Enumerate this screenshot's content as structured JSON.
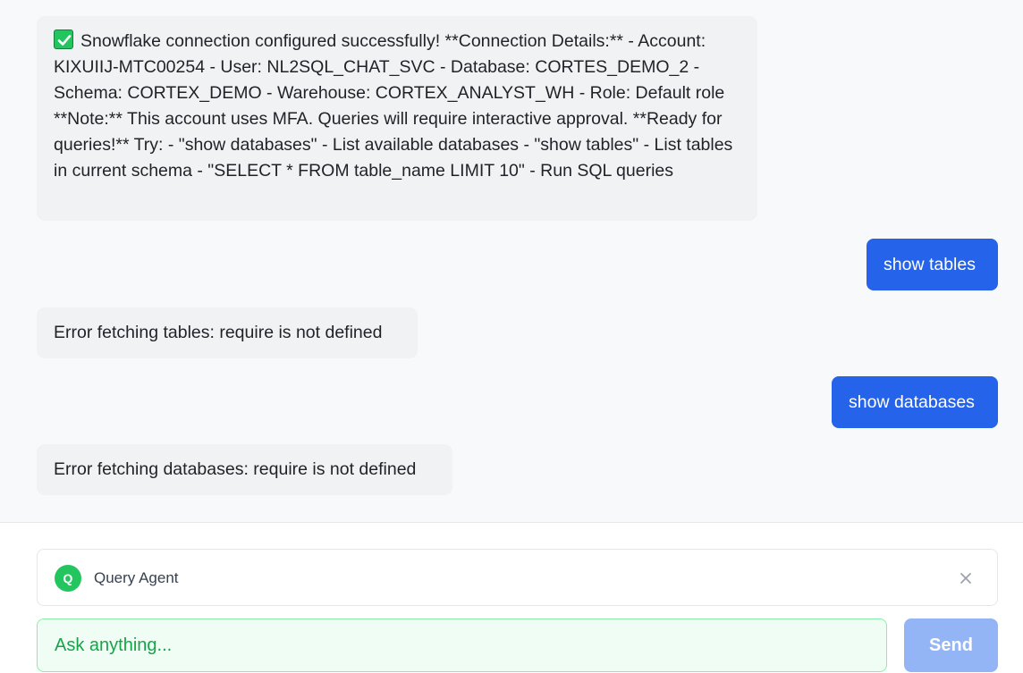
{
  "messages": [
    {
      "role": "assistant",
      "icon": "check-box-icon",
      "text": "Snowflake connection configured successfully! **Connection Details:** - Account: KIXUIIJ-MTC00254 - User: NL2SQL_CHAT_SVC - Database: CORTES_DEMO_2 - Schema: CORTEX_DEMO - Warehouse: CORTEX_ANALYST_WH - Role: Default role **Note:** This account uses MFA. Queries will require interactive approval. **Ready for queries!** Try: - \"show databases\" - List available databases - \"show tables\" - List tables in current schema - \"SELECT * FROM table_name LIMIT 10\" - Run SQL queries"
    },
    {
      "role": "user",
      "text": "show tables"
    },
    {
      "role": "assistant",
      "text": "Error fetching tables: require is not defined"
    },
    {
      "role": "user",
      "text": "show databases"
    },
    {
      "role": "assistant",
      "text": "Error fetching databases: require is not defined"
    }
  ],
  "agent": {
    "avatar_letter": "Q",
    "name": "Query Agent",
    "close_icon": "close-icon"
  },
  "input": {
    "placeholder": "Ask anything...",
    "value": ""
  },
  "send_button": {
    "label": "Send"
  },
  "colors": {
    "user_bubble": "#2563eb",
    "assistant_bubble": "#f1f2f4",
    "agent_avatar": "#22c55e",
    "input_border": "#86efac",
    "send_disabled": "#93b4f5"
  }
}
